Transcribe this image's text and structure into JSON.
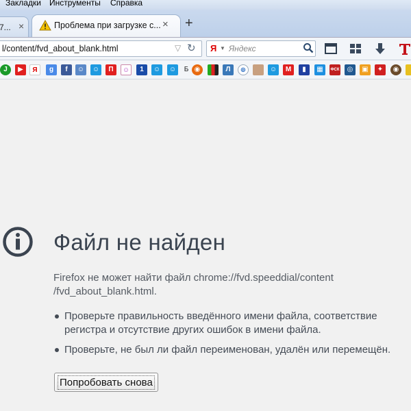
{
  "menu": {
    "items": [
      "Закладки",
      "Инструменты",
      "Справка"
    ]
  },
  "tabs": {
    "inactive_label": "7...",
    "active_title": "Проблема при загрузке с...",
    "new_tab": "+",
    "close": "×"
  },
  "navbar": {
    "url": "l/content/fvd_about_blank.html",
    "search_engine": "Я",
    "search_placeholder": "Яндекс"
  },
  "bookmarks": {
    "letter_b": "Б"
  },
  "error": {
    "title": "Файл не найден",
    "description": "Firefox не может найти файл chrome://fvd.speeddial/content /fvd_about_blank.html.",
    "items": [
      "Проверьте правильность введённого имени файла, соответствие регистра и отсутствие других ошибок в имени файла.",
      "Проверьте, не был ли файл переименован, удалён или перемещён."
    ],
    "retry_label": "Попробовать снова"
  },
  "colors": {
    "title": "#3b4450",
    "text": "#555b63",
    "background": "#f1f1f1"
  }
}
